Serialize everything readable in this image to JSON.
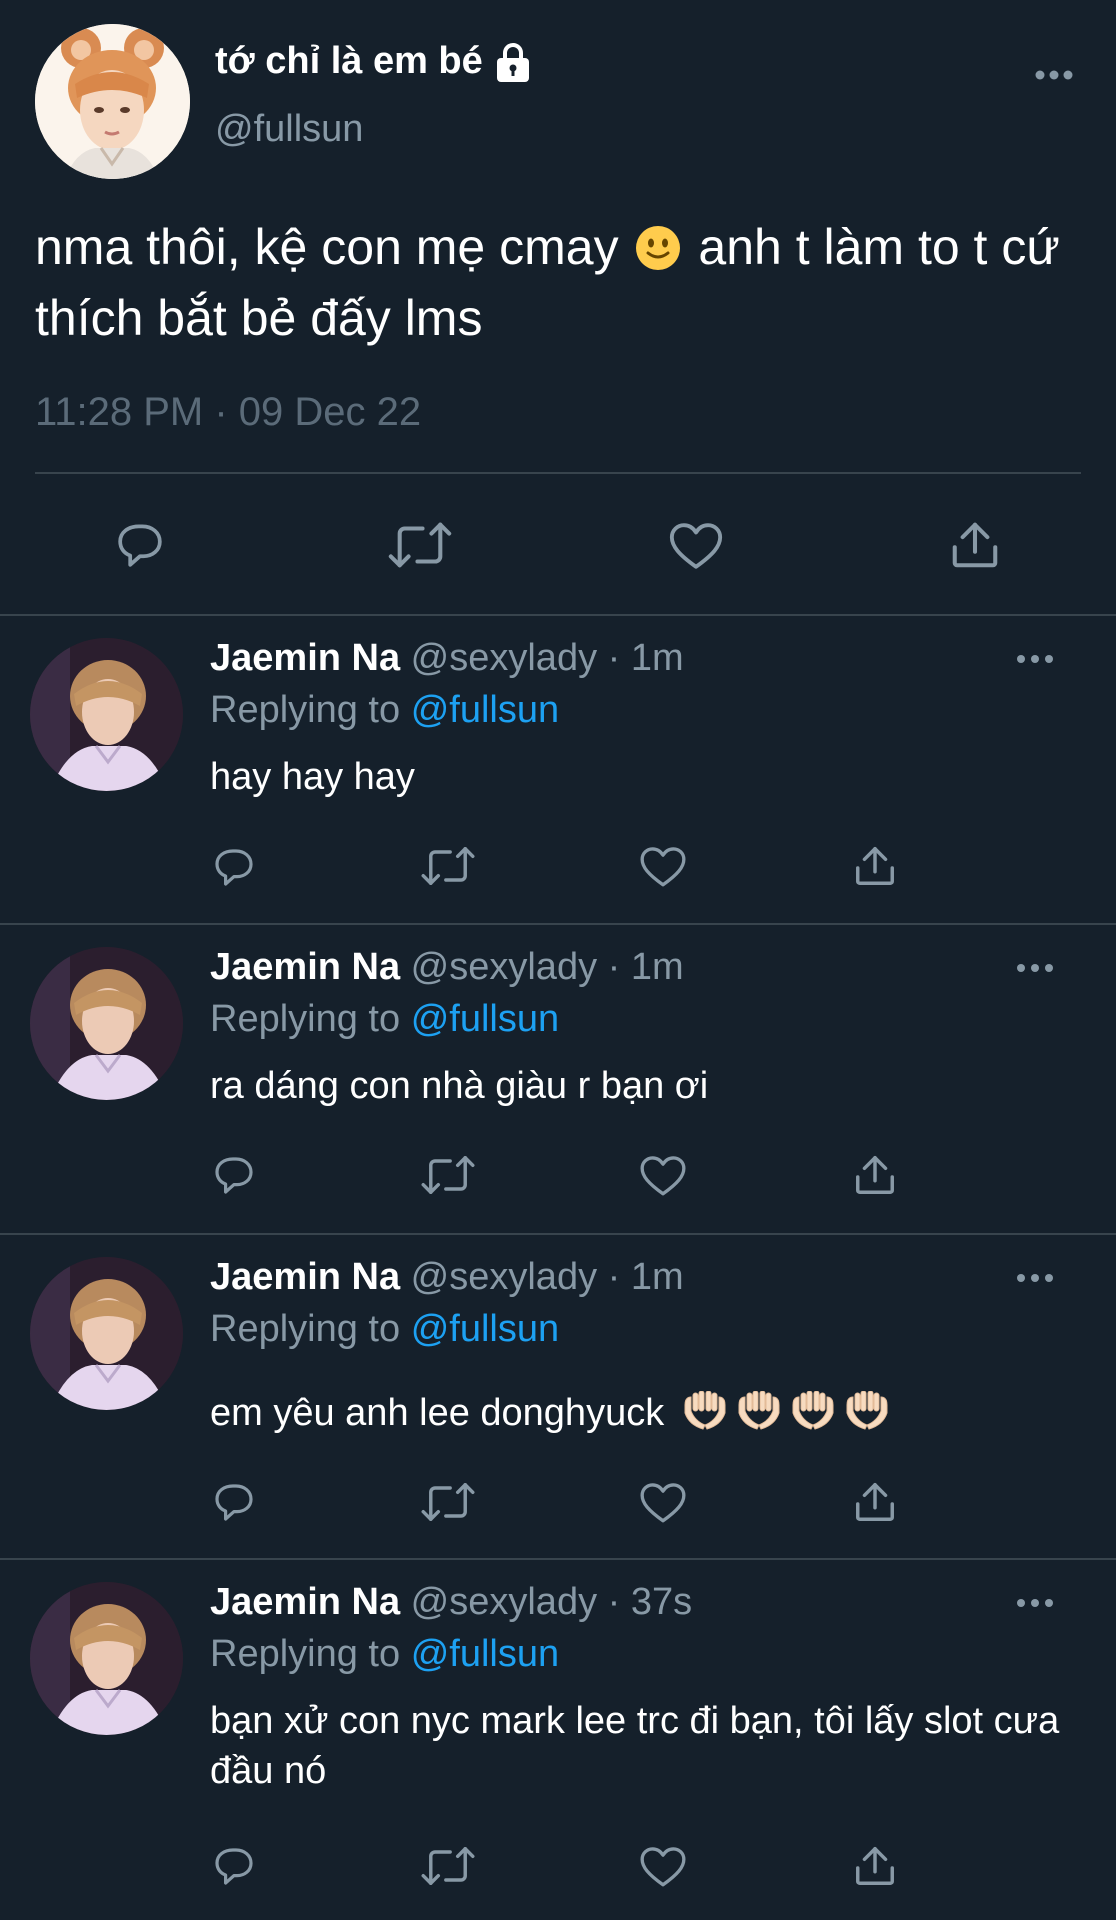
{
  "main_tweet": {
    "display_name": "tớ chỉ là em bé",
    "handle": "@fullsun",
    "text_part1": "nma thôi, kệ con mẹ cmay",
    "emoji": "slightly-smiling-face",
    "text_part2": "anh t làm to t cứ thích bắt bẻ đấy lms",
    "timestamp": "11:28 PM · 09 Dec 22",
    "locked": true
  },
  "replies": [
    {
      "name": "Jaemin Na",
      "meta": "@sexylady · 1m",
      "replying_prefix": "Replying to",
      "replying_to": "@fullsun",
      "text": "hay hay hay"
    },
    {
      "name": "Jaemin Na",
      "meta": "@sexylady · 1m",
      "replying_prefix": "Replying to",
      "replying_to": "@fullsun",
      "text": "ra dáng con nhà giàu r bạn ơi"
    },
    {
      "name": "Jaemin Na",
      "meta": "@sexylady · 1m",
      "replying_prefix": "Replying to",
      "replying_to": "@fullsun",
      "text": "em yêu anh lee donghyuck",
      "emoji": "palms-up-together",
      "emoji_count": 4
    },
    {
      "name": "Jaemin Na",
      "meta": "@sexylady · 37s",
      "replying_prefix": "Replying to",
      "replying_to": "@fullsun",
      "text": "bạn xử con nyc mark lee trc đi bạn, tôi lấy slot cưa đầu nó"
    }
  ],
  "colors": {
    "background": "#15202b",
    "border": "#38444d",
    "secondary_text": "#8899a6",
    "link": "#1da1f2"
  }
}
